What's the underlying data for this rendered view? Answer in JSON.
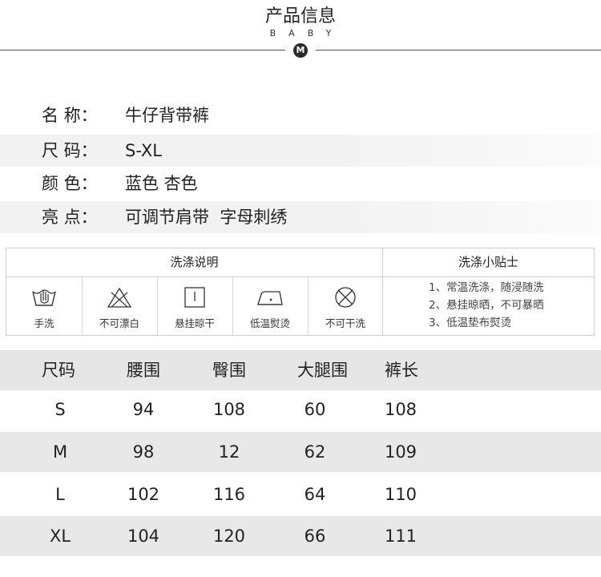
{
  "header": {
    "title": "产品信息",
    "subtitle": "BABY",
    "badge": "M"
  },
  "info": [
    {
      "label": "名  称：",
      "value": "牛仔背带裤"
    },
    {
      "label": "尺  码：",
      "value": "S-XL"
    },
    {
      "label": "颜  色：",
      "value": "蓝色 杏色"
    },
    {
      "label": "亮  点：",
      "value": "可调节肩带  字母刺绣"
    }
  ],
  "care": {
    "left_title": "洗涤说明",
    "right_title": "洗涤小贴士",
    "icons": [
      {
        "icon": "hand-wash-icon",
        "caption": "手洗"
      },
      {
        "icon": "no-bleach-icon",
        "caption": "不可漂白"
      },
      {
        "icon": "hang-dry-icon",
        "caption": "悬挂晾干"
      },
      {
        "icon": "low-iron-icon",
        "caption": "低温熨烫"
      },
      {
        "icon": "no-dry-clean-icon",
        "caption": "不可干洗"
      }
    ],
    "tips": [
      "1、常温洗涤，随浸随洗",
      "2、悬挂晾晒，不可暴晒",
      "3、低温垫布熨烫"
    ]
  },
  "size_table": {
    "headers": [
      "尺码",
      "腰围",
      "臀围",
      "大腿围",
      "裤长"
    ],
    "rows": [
      [
        "S",
        "94",
        "108",
        "60",
        "108"
      ],
      [
        "M",
        "98",
        "12",
        "62",
        "109"
      ],
      [
        "L",
        "102",
        "116",
        "64",
        "110"
      ],
      [
        "XL",
        "104",
        "120",
        "66",
        "111"
      ]
    ]
  }
}
